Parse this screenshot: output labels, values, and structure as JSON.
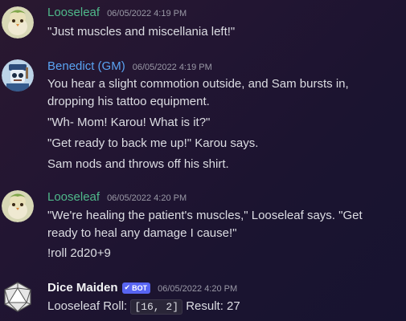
{
  "messages": [
    {
      "author": "Looseleaf",
      "timestamp": "06/05/2022 4:19 PM",
      "lines": [
        "\"Just muscles and miscellania left!\""
      ]
    },
    {
      "author": "Benedict (GM)",
      "timestamp": "06/05/2022 4:19 PM",
      "lines": [
        "You hear a slight commotion outside, and Sam bursts in,",
        "dropping his tattoo equipment.",
        "\"Wh- Mom! Karou! What is it?\"",
        "\"Get ready to back me up!\" Karou says.",
        "Sam nods and throws off his shirt."
      ]
    },
    {
      "author": "Looseleaf",
      "timestamp": "06/05/2022 4:20 PM",
      "lines": [
        "\"We're healing the patient's muscles,\" Looseleaf says. \"Get",
        "ready to heal any damage I cause!\"",
        "!roll 2d20+9"
      ]
    },
    {
      "author": "Dice Maiden",
      "badge": "BOT",
      "timestamp": "06/05/2022 4:20 PM",
      "roll_prefix": "Looseleaf Roll:",
      "roll_code": "[16, 2]",
      "roll_result": "Result: 27"
    }
  ],
  "colors": {
    "looseleaf": "#4fb98a",
    "gm": "#5aa3f2",
    "bot_badge": "#5865f2"
  },
  "icons": {
    "looseleaf_avatar": "bird-avatar-icon",
    "gm_avatar": "robot-avatar-icon",
    "dice_avatar": "d20-dice-icon"
  }
}
